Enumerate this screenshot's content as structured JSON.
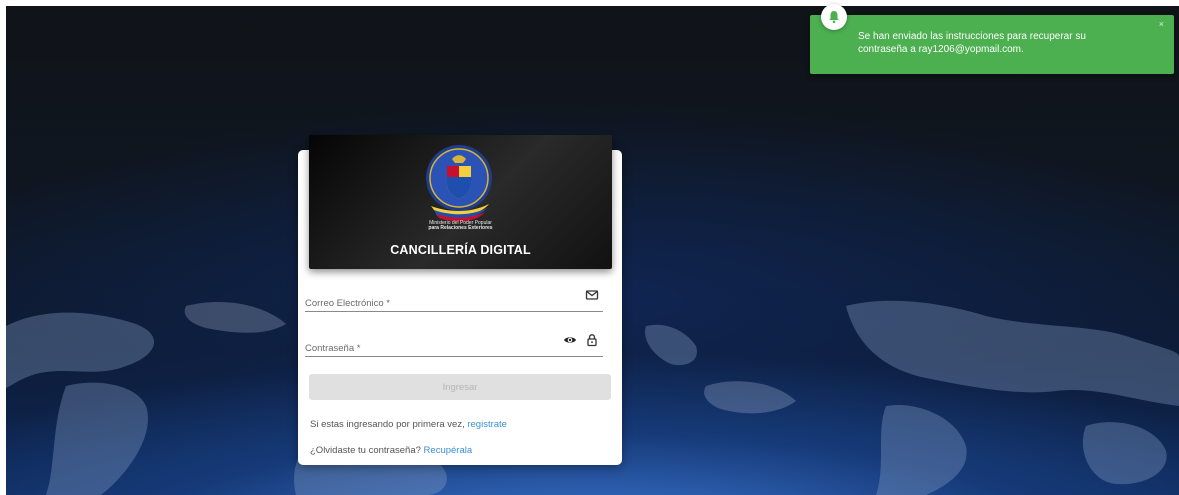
{
  "banner": {
    "ministry_line1": "Ministerio del Poder Popular",
    "ministry_line2": "para Relaciones Exteriores",
    "title": "CANCILLERÍA DIGITAL"
  },
  "form": {
    "email_placeholder": "Correo Electrónico *",
    "password_placeholder": "Contraseña *",
    "submit_label": "Ingresar",
    "first_time_text": "Si estas ingresando por primera vez, ",
    "register_link": "registrate",
    "forgot_text": "¿Olvidaste tu contraseña? ",
    "recover_link": "Recupérala"
  },
  "toast": {
    "message": "Se han enviado las instrucciones para recuperar su contraseña a ray1206@yopmail.com.",
    "close_label": "×",
    "icon": "bell-icon"
  },
  "icons": {
    "email": "mail-icon",
    "visibility": "eye-icon",
    "lock": "lock-icon"
  },
  "colors": {
    "toast_bg": "#4caf50",
    "link": "#3d8fd6",
    "button_disabled_bg": "#e0e0e0"
  }
}
